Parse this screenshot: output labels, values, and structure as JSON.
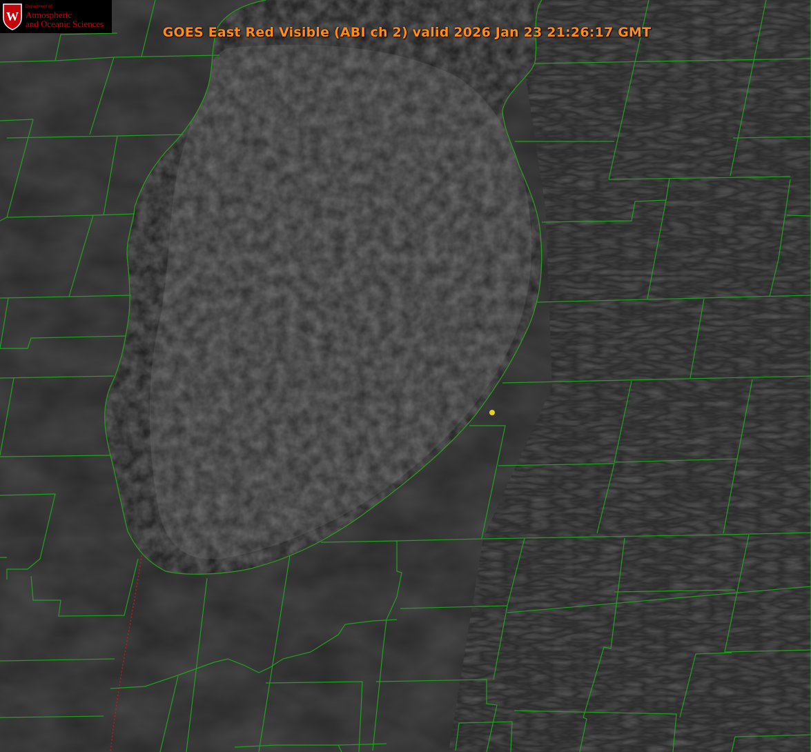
{
  "title": "GOES East Red Visible (ABI ch 2) valid 2026 Jan 23 21:26:17 GMT",
  "logo": {
    "dept": "Department of",
    "line1": "Atmospheric",
    "line2": "and Oceanic Sciences",
    "crest_letter": "W"
  },
  "colors": {
    "title": "#ff8c1a",
    "county_lines": "#1fa31f",
    "state_lines": "#d01818",
    "marker": "#e6d21a",
    "lake": "#1c1c1c",
    "land": "#2a2a2a",
    "logo_red": "#c5050c"
  },
  "marker": {
    "icon": "location-dot"
  }
}
